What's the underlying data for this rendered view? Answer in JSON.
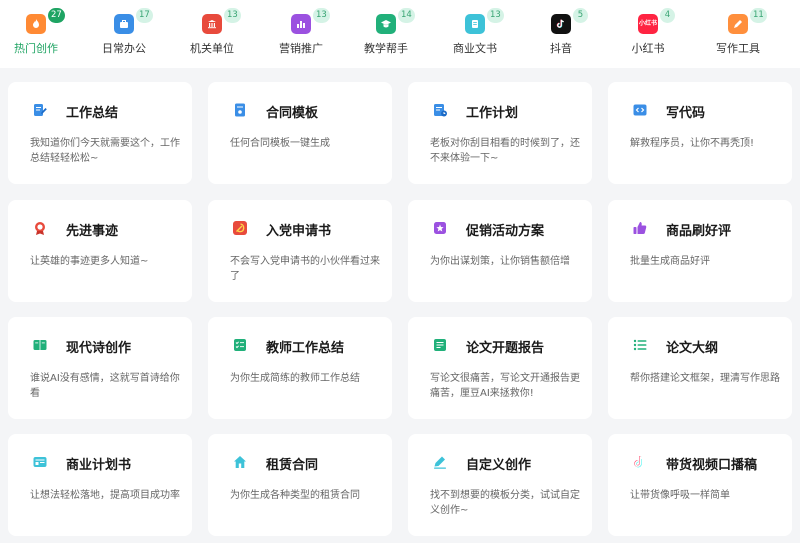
{
  "tabs": [
    {
      "label": "热门创作",
      "count": "27",
      "icon": "flame-icon",
      "color": "#ff8a34"
    },
    {
      "label": "日常办公",
      "count": "17",
      "icon": "briefcase-icon",
      "color": "#3a8ee6"
    },
    {
      "label": "机关单位",
      "count": "13",
      "icon": "institution-icon",
      "color": "#e84a3c"
    },
    {
      "label": "营销推广",
      "count": "13",
      "icon": "bar-chart-icon",
      "color": "#9b51e0"
    },
    {
      "label": "教学帮手",
      "count": "14",
      "icon": "graduation-cap-icon",
      "color": "#21b07a"
    },
    {
      "label": "商业文书",
      "count": "13",
      "icon": "document-icon",
      "color": "#3dc2d8"
    },
    {
      "label": "抖音",
      "count": "5",
      "icon": "tiktok-icon",
      "color": "#111111"
    },
    {
      "label": "小红书",
      "count": "4",
      "icon": "xiaohongshu-icon",
      "color": "#ff2442",
      "icon_text": "小红书"
    },
    {
      "label": "写作工具",
      "count": "11",
      "icon": "pen-tool-icon",
      "color": "#ff8f3c"
    }
  ],
  "active_tab": "热门创作",
  "accent": "#1fa463",
  "cards": [
    {
      "title": "工作总结",
      "desc": "我知道你们今天就需要这个，工作总结轻轻松松~",
      "icon": "edit-document-icon",
      "color": "#3a8ee6"
    },
    {
      "title": "合同模板",
      "desc": "任何合同模板一键生成",
      "icon": "contract-icon",
      "color": "#3a8ee6"
    },
    {
      "title": "工作计划",
      "desc": "老板对你刮目相看的时候到了，还不来体验一下~",
      "icon": "plan-icon",
      "color": "#3a8ee6"
    },
    {
      "title": "写代码",
      "desc": "解救程序员，让你不再秃顶!",
      "icon": "code-icon",
      "color": "#3a8ee6"
    },
    {
      "title": "先进事迹",
      "desc": "让英雄的事迹更多人知道~",
      "icon": "medal-icon",
      "color": "#e84a3c"
    },
    {
      "title": "入党申请书",
      "desc": "不会写入党申请书的小伙伴看过来了",
      "icon": "party-emblem-icon",
      "color": "#e84a3c"
    },
    {
      "title": "促销活动方案",
      "desc": "为你出谋划策，让你销售额倍增",
      "icon": "promotion-icon",
      "color": "#9b51e0"
    },
    {
      "title": "商品刷好评",
      "desc": "批量生成商品好评",
      "icon": "thumbs-up-icon",
      "color": "#9b51e0"
    },
    {
      "title": "现代诗创作",
      "desc": "谁说AI没有感情，这就写首诗给你看",
      "icon": "book-icon",
      "color": "#21b07a"
    },
    {
      "title": "教师工作总结",
      "desc": "为你生成简练的教师工作总结",
      "icon": "checklist-icon",
      "color": "#21b07a"
    },
    {
      "title": "论文开题报告",
      "desc": "写论文很痛苦，写论文开通报告更痛苦，厘豆AI来拯救你!",
      "icon": "report-icon",
      "color": "#21b07a"
    },
    {
      "title": "论文大纲",
      "desc": "帮你搭建论文框架，理清写作思路",
      "icon": "outline-list-icon",
      "color": "#21b07a"
    },
    {
      "title": "商业计划书",
      "desc": "让想法轻松落地，提高项目成功率",
      "icon": "business-plan-icon",
      "color": "#3dc2d8"
    },
    {
      "title": "租赁合同",
      "desc": "为你生成各种类型的租赁合同",
      "icon": "house-icon",
      "color": "#3dc2d8"
    },
    {
      "title": "自定义创作",
      "desc": "找不到想要的模板分类，试试自定义创作~",
      "icon": "pen-icon",
      "color": "#3dc2d8"
    },
    {
      "title": "带货视频口播稿",
      "desc": "让带货像呼吸一样简单",
      "icon": "tiktok-icon",
      "color": "#111111"
    }
  ]
}
